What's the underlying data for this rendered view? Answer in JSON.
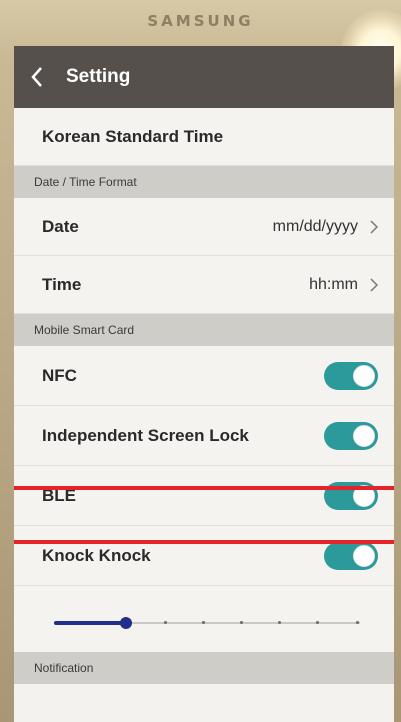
{
  "device": {
    "brand": "SAMSUNG"
  },
  "header": {
    "title": "Setting",
    "back_icon": "chevron-left-icon"
  },
  "timezone": {
    "label": "Korean Standard Time"
  },
  "sections": {
    "datetime_format": "Date / Time Format",
    "mobile_smart_card": "Mobile Smart Card",
    "notification": "Notification"
  },
  "date_row": {
    "label": "Date",
    "value": "mm/dd/yyyy"
  },
  "time_row": {
    "label": "Time",
    "value": "hh:mm"
  },
  "toggles": [
    {
      "label": "NFC",
      "on": true
    },
    {
      "label": "Independent Screen Lock",
      "on": true
    },
    {
      "label": "BLE",
      "on": true
    },
    {
      "label": "Knock Knock",
      "on": true
    }
  ],
  "slider": {
    "steps": 8,
    "value_step": 2
  },
  "colors": {
    "toggle_on": "#2c9a9a",
    "titlebar": "#55504b",
    "highlight": "#e5232b",
    "slider": "#1f2f8a"
  }
}
